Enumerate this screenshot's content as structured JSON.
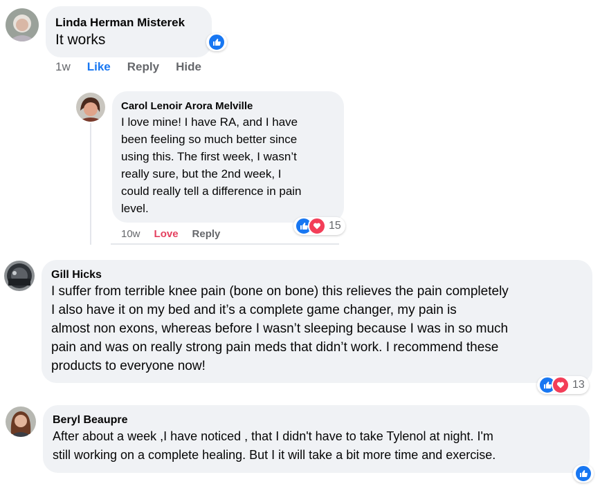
{
  "comments": [
    {
      "author": "Linda Herman Misterek",
      "text": "It works",
      "time": "1w",
      "actions": [
        "Like",
        "Reply",
        "Hide"
      ],
      "reaction_icons": [
        "like-icon"
      ],
      "reaction_count": ""
    },
    {
      "author": "Carol Lenoir Arora Melville",
      "lines": [
        "I love mine! I have RA, and I have",
        "been feeling so much better since",
        "using this. The first week, I wasn’t",
        "really sure, but the 2nd week, I",
        "could really tell a difference in pain",
        "level."
      ],
      "time": "10w",
      "actions": [
        "Love",
        "Reply"
      ],
      "reaction_icons": [
        "like-icon",
        "love-icon"
      ],
      "reaction_count": "15"
    },
    {
      "author": "Gill Hicks",
      "lines": [
        "I suffer from terrible knee pain (bone on bone) this relieves the pain completely",
        "I also have it on my bed and it’s a complete game changer, my pain is",
        "almost non exons, whereas before I wasn’t sleeping because I was in so much",
        "pain and was on really strong pain meds that didn’t work. I recommend these",
        "products to everyone now!"
      ],
      "reaction_icons": [
        "like-icon",
        "love-icon"
      ],
      "reaction_count": "13"
    },
    {
      "author": "Beryl Beaupre",
      "lines": [
        "After about a week ,I have noticed , that I didn't have to take Tylenol at night. I'm",
        "still working on a complete healing. But I it will take a bit more time and exercise."
      ],
      "reaction_icons": [
        "like-icon"
      ],
      "reaction_count": ""
    }
  ],
  "colors": {
    "bubble": "#f0f2f5",
    "like_blue": "#1877f2",
    "love_red": "#f33e58",
    "love_text": "#e4405f",
    "meta_gray": "#65676b"
  }
}
